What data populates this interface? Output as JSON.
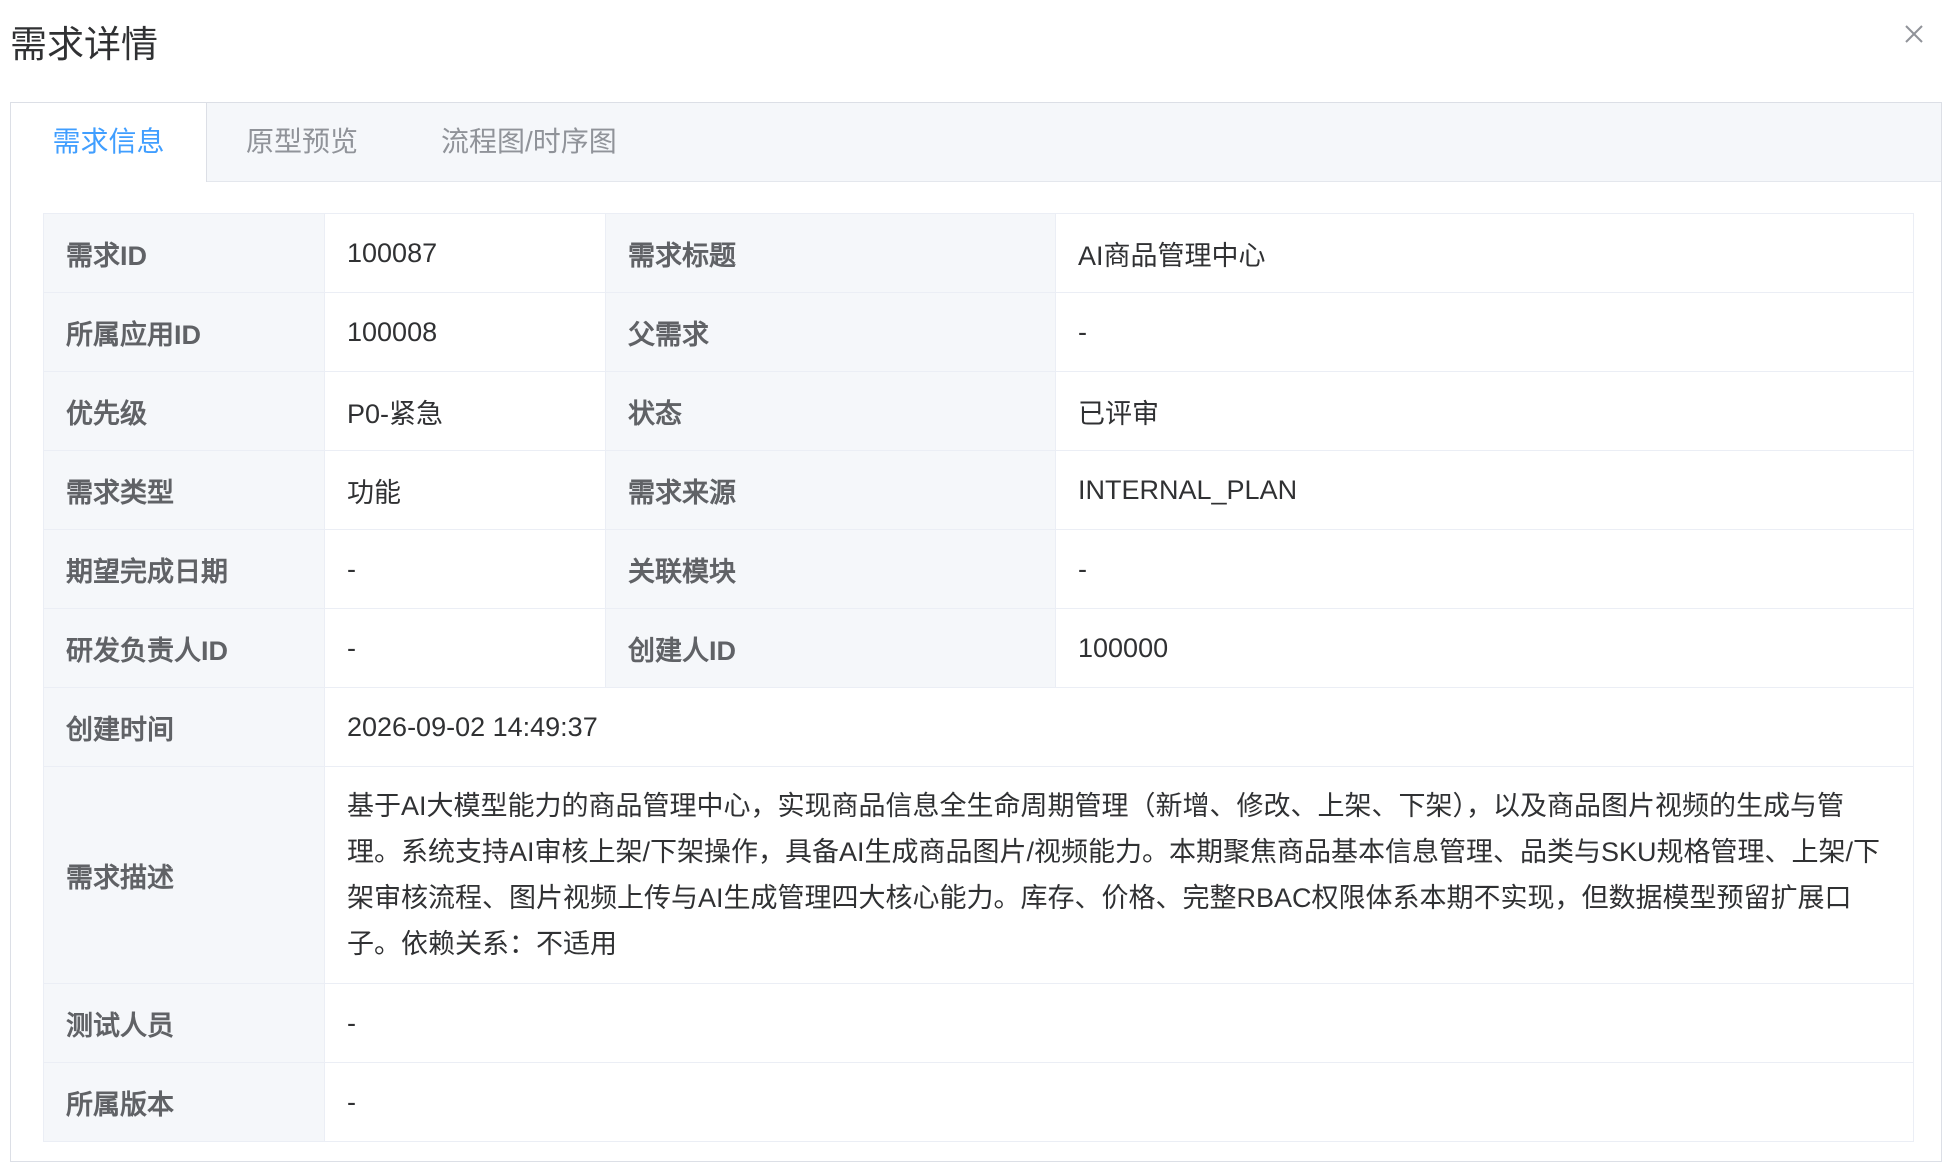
{
  "dialog": {
    "title": "需求详情"
  },
  "tabs": [
    {
      "label": "需求信息",
      "active": true
    },
    {
      "label": "原型预览",
      "active": false
    },
    {
      "label": "流程图/时序图",
      "active": false
    }
  ],
  "fields": {
    "req_id": {
      "label": "需求ID",
      "value": "100087"
    },
    "req_title": {
      "label": "需求标题",
      "value": "AI商品管理中心"
    },
    "app_id": {
      "label": "所属应用ID",
      "value": "100008"
    },
    "parent": {
      "label": "父需求",
      "value": "-"
    },
    "priority": {
      "label": "优先级",
      "value": "P0-紧急"
    },
    "status": {
      "label": "状态",
      "value": "已评审"
    },
    "type": {
      "label": "需求类型",
      "value": "功能"
    },
    "source": {
      "label": "需求来源",
      "value": "INTERNAL_PLAN"
    },
    "due_date": {
      "label": "期望完成日期",
      "value": "-"
    },
    "module": {
      "label": "关联模块",
      "value": "-"
    },
    "dev_owner": {
      "label": "研发负责人ID",
      "value": "-"
    },
    "creator": {
      "label": "创建人ID",
      "value": "100000"
    },
    "created_at": {
      "label": "创建时间",
      "value": "2026-09-02 14:49:37"
    },
    "description": {
      "label": "需求描述",
      "value": "基于AI大模型能力的商品管理中心，实现商品信息全生命周期管理（新增、修改、上架、下架），以及商品图片视频的生成与管理。系统支持AI审核上架/下架操作，具备AI生成商品图片/视频能力。本期聚焦商品基本信息管理、品类与SKU规格管理、上架/下架审核流程、图片视频上传与AI生成管理四大核心能力。库存、价格、完整RBAC权限体系本期不实现，但数据模型预留扩展口子。依赖关系：不适用"
    },
    "testers": {
      "label": "测试人员",
      "value": "-"
    },
    "version": {
      "label": "所属版本",
      "value": "-"
    }
  },
  "colors": {
    "accent": "#409eff",
    "label_bg": "#f5f7fa",
    "border": "#ebeef5"
  },
  "icons": {
    "close": "close-icon"
  }
}
